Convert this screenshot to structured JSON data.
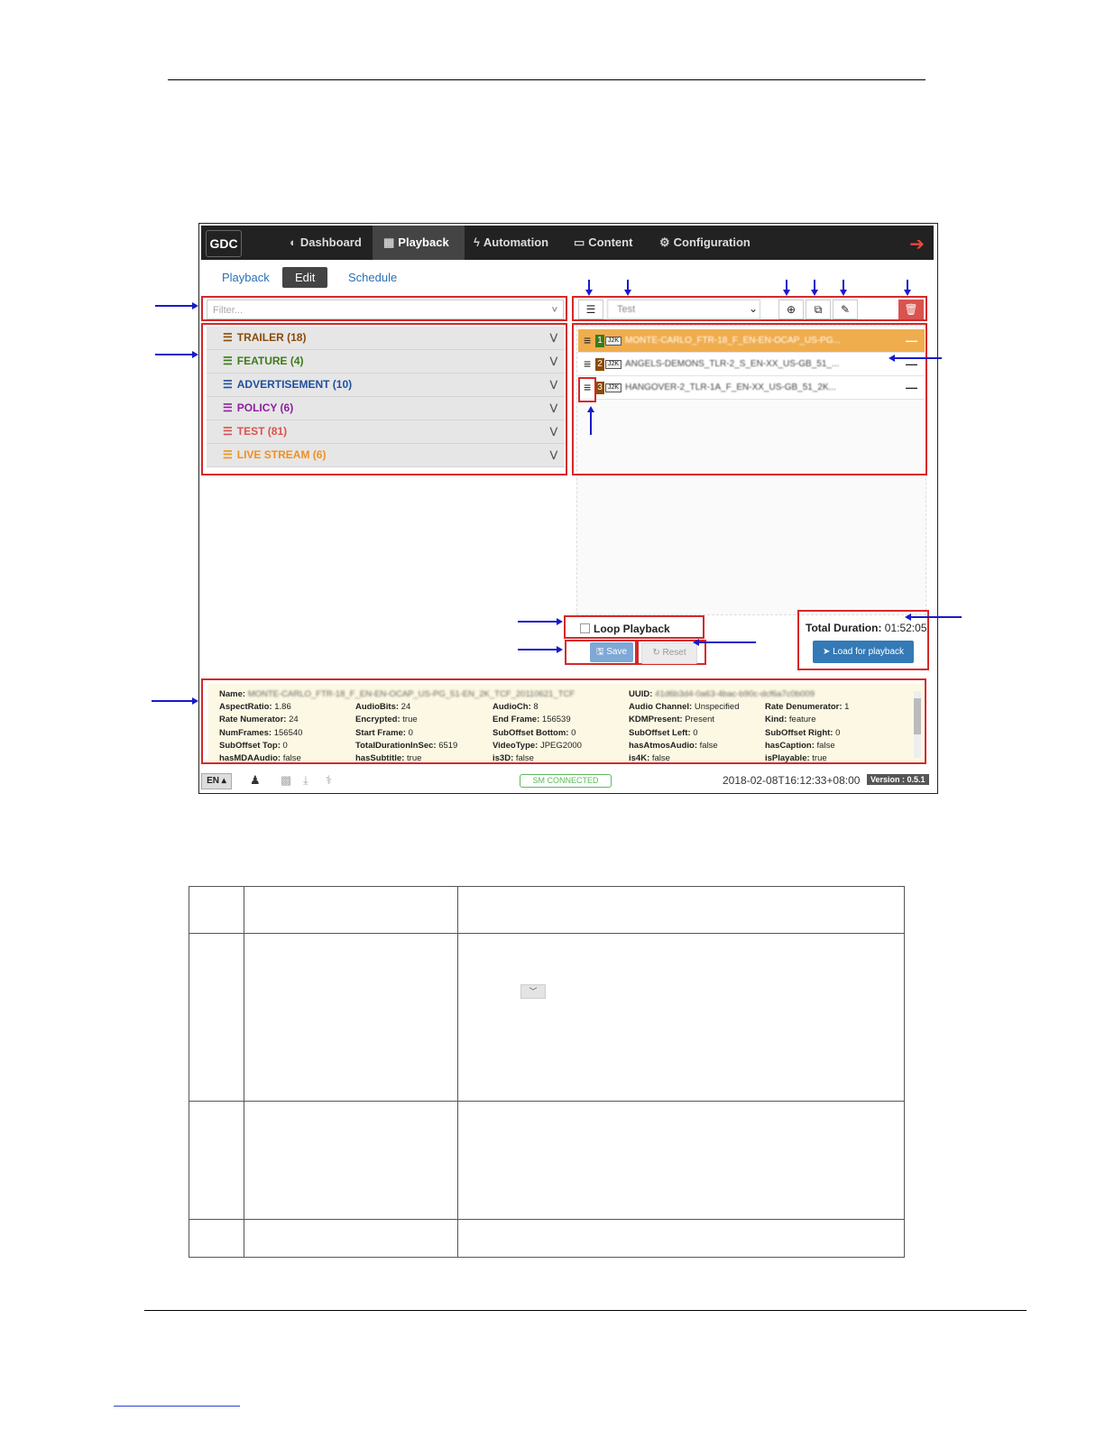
{
  "nav": {
    "logo": "GDC",
    "items": [
      {
        "label": "Dashboard",
        "icon": "dashboard-icon",
        "glyph": "◐"
      },
      {
        "label": "Playback",
        "icon": "film-icon",
        "glyph": "▦"
      },
      {
        "label": "Automation",
        "icon": "bolt-icon",
        "glyph": "ϟ"
      },
      {
        "label": "Content",
        "icon": "drive-icon",
        "glyph": "▭"
      },
      {
        "label": "Configuration",
        "icon": "gears-icon",
        "glyph": "⚙"
      }
    ],
    "active": "Playback",
    "logout_glyph": "➔"
  },
  "subtabs": {
    "playback": "Playback",
    "edit": "Edit",
    "schedule": "Schedule"
  },
  "filter": {
    "placeholder": "Filter...",
    "caret": "˅"
  },
  "categories": [
    {
      "label": "TRAILER (18)",
      "color": "#8a4b08"
    },
    {
      "label": "FEATURE (4)",
      "color": "#3c7a1a"
    },
    {
      "label": "ADVERTISEMENT (10)",
      "color": "#1f4fa0"
    },
    {
      "label": "POLICY (6)",
      "color": "#8e1fa0"
    },
    {
      "label": "TEST (81)",
      "color": "#d9534f"
    },
    {
      "label": "LIVE STREAM (6)",
      "color": "#f0901e"
    }
  ],
  "playlist": {
    "selected_name": "Test",
    "items": [
      {
        "index": "1",
        "badge_color": "#3c7a1a",
        "format": "J2K",
        "name": "MONTE-CARLO_FTR-18_F_EN-EN-OCAP_US-PG...",
        "selected": true
      },
      {
        "index": "2",
        "badge_color": "#8a4b08",
        "format": "J2K",
        "name": "ANGELS-DEMONS_TLR-2_S_EN-XX_US-GB_51_...",
        "selected": false
      },
      {
        "index": "3",
        "badge_color": "#8a4b08",
        "format": "J2K",
        "name": "HANGOVER-2_TLR-1A_F_EN-XX_US-GB_51_2K...",
        "selected": false
      }
    ]
  },
  "controls": {
    "loop_label": "Loop Playback",
    "save_label": "Save",
    "reset_label": "Reset",
    "total_duration_label": "Total Duration:",
    "total_duration_value": "01:52:05",
    "load_label": "Load for playback"
  },
  "info": {
    "name_label": "Name:",
    "name_value": "MONTE-CARLO_FTR-18_F_EN-EN-OCAP_US-PG_51-EN_2K_TCF_20110621_TCF",
    "uuid_label": "UUID:",
    "uuid_value": "41d6b3d4-0a63-4bac-b90c-dcf6a7c0b009",
    "rows": [
      [
        [
          "AspectRatio:",
          "1.86"
        ],
        [
          "AudioBits:",
          "24"
        ],
        [
          "AudioCh:",
          "8"
        ],
        [
          "Audio Channel:",
          "Unspecified"
        ],
        [
          "Rate Denumerator:",
          "1"
        ]
      ],
      [
        [
          "Rate Numerator:",
          "24"
        ],
        [
          "Encrypted:",
          "true"
        ],
        [
          "End Frame:",
          "156539"
        ],
        [
          "KDMPresent:",
          "Present"
        ],
        [
          "Kind:",
          "feature"
        ]
      ],
      [
        [
          "NumFrames:",
          "156540"
        ],
        [
          "Start Frame:",
          "0"
        ],
        [
          "SubOffset Bottom:",
          "0"
        ],
        [
          "SubOffset Left:",
          "0"
        ],
        [
          "SubOffset Right:",
          "0"
        ]
      ],
      [
        [
          "SubOffset Top:",
          "0"
        ],
        [
          "TotalDurationInSec:",
          "6519"
        ],
        [
          "VideoType:",
          "JPEG2000"
        ],
        [
          "hasAtmosAudio:",
          "false"
        ],
        [
          "hasCaption:",
          "false"
        ]
      ],
      [
        [
          "hasMDAAudio:",
          "false"
        ],
        [
          "hasSubtitle:",
          "true"
        ],
        [
          "is3D:",
          "false"
        ],
        [
          "is4K:",
          "false"
        ],
        [
          "isPlayable:",
          "true"
        ]
      ]
    ]
  },
  "footer": {
    "lang": "EN ▴",
    "status": "SM CONNECTED",
    "timestamp": "2018-02-08T16:12:33+08:00",
    "version": "Version : 0.5.1"
  }
}
